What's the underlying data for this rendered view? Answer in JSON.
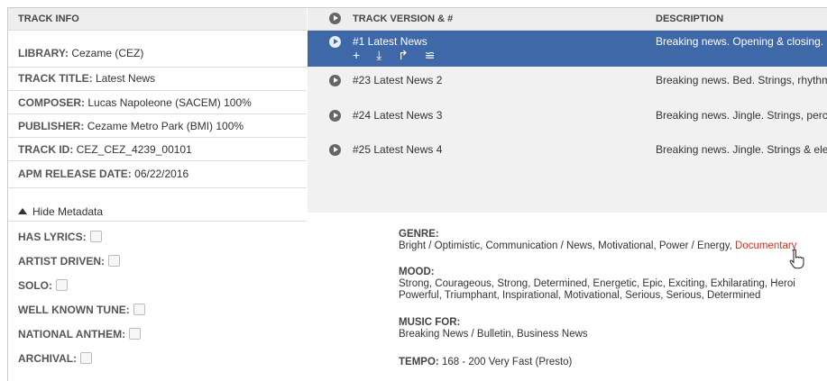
{
  "track_info": {
    "header": "TRACK INFO",
    "rows": [
      {
        "label": "LIBRARY:",
        "value": "Cezame (CEZ)"
      },
      {
        "label": "TRACK TITLE:",
        "value": "Latest News"
      },
      {
        "label": "COMPOSER:",
        "value": "Lucas Napoleone (SACEM) 100%"
      },
      {
        "label": "PUBLISHER:",
        "value": "Cezame Metro Park (BMI) 100%"
      },
      {
        "label": "TRACK ID:",
        "value": "CEZ_CEZ_4239_00101"
      },
      {
        "label": "APM RELEASE DATE:",
        "value": "06/22/2016"
      }
    ],
    "toggle_label": "Hide Metadata",
    "flags": [
      {
        "label": "HAS LYRICS:"
      },
      {
        "label": "ARTIST DRIVEN:"
      },
      {
        "label": "SOLO:"
      },
      {
        "label": "WELL KNOWN TUNE:"
      },
      {
        "label": "NATIONAL ANTHEM:"
      },
      {
        "label": "ARCHIVAL:"
      }
    ]
  },
  "versions": {
    "header_version": "TRACK VERSION & #",
    "header_description": "DESCRIPTION",
    "rows": [
      {
        "title": "#1 Latest News",
        "description": "Breaking news. Opening & closing."
      },
      {
        "title": "#23 Latest News 2",
        "description": "Breaking news. Bed. Strings, rhythm"
      },
      {
        "title": "#24 Latest News 3",
        "description": "Breaking news. Jingle. Strings, perc"
      },
      {
        "title": "#25 Latest News 4",
        "description": "Breaking news. Jingle. Strings & ele"
      }
    ],
    "active_tools": [
      "+",
      "⤓",
      "↱",
      "≌"
    ]
  },
  "details": {
    "genre_label": "GENRE:",
    "genre_text": "Bright / Optimistic, Communication / News, Motivational, Power / Energy,",
    "genre_link": "Documentary",
    "mood_label": "MOOD:",
    "mood_line1": "Strong, Courageous, Strong, Determined, Energetic, Epic, Exciting, Exhilarating, Heroi",
    "mood_line2": "Powerful, Triumphant, Inspirational, Motivational, Serious, Serious, Determined",
    "music_for_label": "MUSIC FOR:",
    "music_for_text": "Breaking News / Bulletin, Business News",
    "tempo_label": "TEMPO:",
    "tempo_text": "168 - 200 Very Fast (Presto)"
  },
  "colors": {
    "accent": "#3f68a8",
    "link": "#c0392b"
  }
}
